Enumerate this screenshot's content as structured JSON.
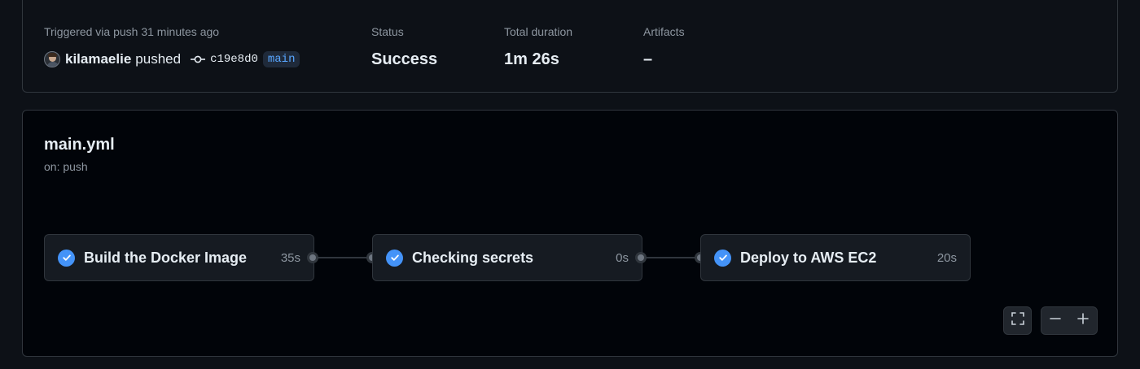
{
  "summary": {
    "trigger_label": "Triggered via push 31 minutes ago",
    "actor": "kilamaelie",
    "action": "pushed",
    "commit_sha": "c19e8d0",
    "branch": "main",
    "status_label": "Status",
    "status_value": "Success",
    "duration_label": "Total duration",
    "duration_value": "1m 26s",
    "artifacts_label": "Artifacts",
    "artifacts_value": "–"
  },
  "workflow": {
    "file": "main.yml",
    "trigger": "on: push",
    "jobs": [
      {
        "name": "Build the Docker Image",
        "duration": "35s",
        "status": "success"
      },
      {
        "name": "Checking secrets",
        "duration": "0s",
        "status": "success"
      },
      {
        "name": "Deploy to AWS EC2",
        "duration": "20s",
        "status": "success"
      }
    ]
  },
  "controls": {
    "fullscreen_icon": "fullscreen-icon",
    "zoom_out_icon": "minus-icon",
    "zoom_in_icon": "plus-icon"
  },
  "colors": {
    "background": "#0d1117",
    "graph_background": "#010409",
    "success_accent": "#4493f8",
    "branch_text": "#58a6ff"
  }
}
